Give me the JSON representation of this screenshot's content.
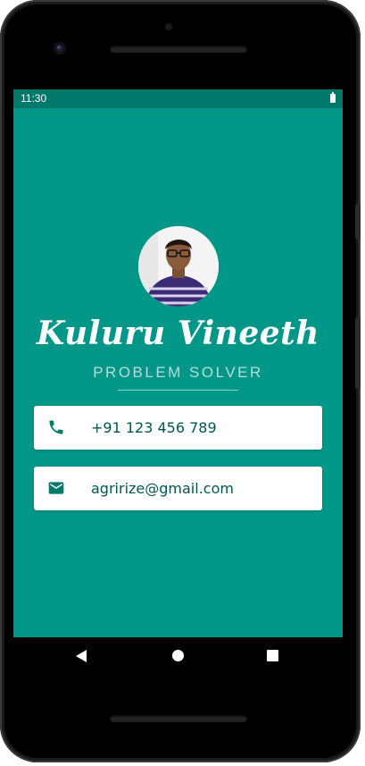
{
  "status_bar": {
    "time": "11:30",
    "battery_icon": "battery-full-icon"
  },
  "profile": {
    "name": "Kuluru Vineeth",
    "title": "PROBLEM SOLVER",
    "avatar_icon": "profile-photo"
  },
  "contacts": [
    {
      "icon": "phone-icon",
      "text": "+91 123 456 789"
    },
    {
      "icon": "email-icon",
      "text": "agririze@gmail.com"
    }
  ],
  "navigation": {
    "back_icon": "back-triangle-icon",
    "home_icon": "home-circle-icon",
    "recents_icon": "recents-square-icon"
  },
  "colors": {
    "background": "#009688",
    "status_bar": "#00796b",
    "card": "#ffffff",
    "card_text": "#00574f",
    "icon": "#00796b",
    "subtitle": "#b2dfdb"
  }
}
